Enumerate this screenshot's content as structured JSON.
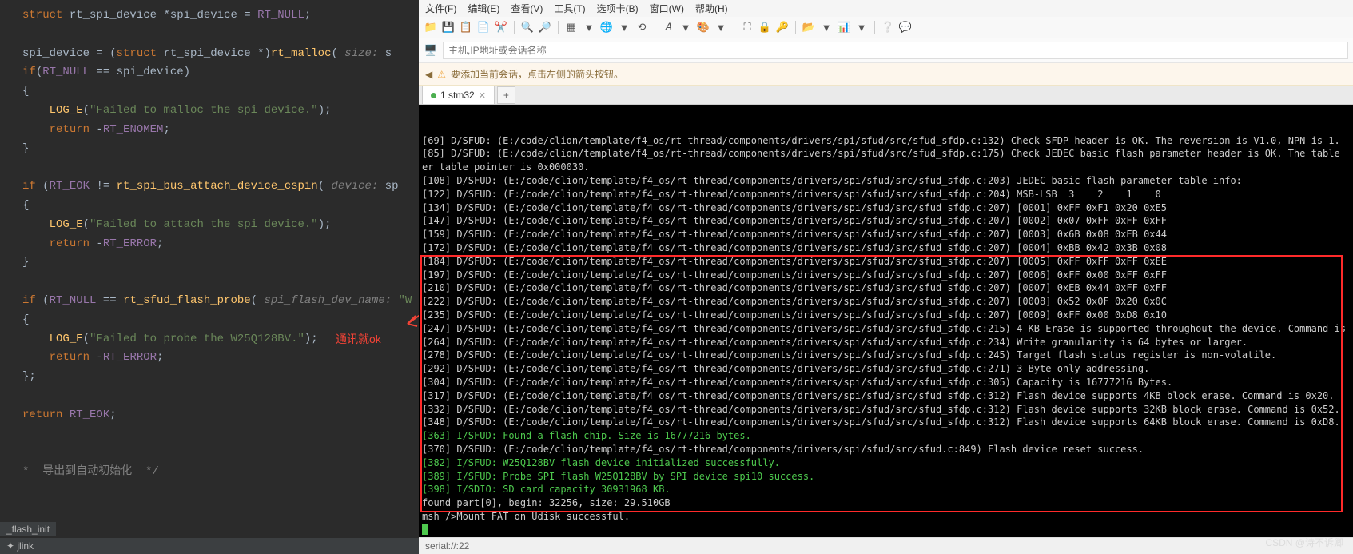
{
  "editor": {
    "bottom_tab": "_flash_init",
    "status": "✦ jlink",
    "annotation": "通讯就ok",
    "code_tokens": [
      [
        {
          "c": "kw",
          "t": "struct"
        },
        {
          "c": "",
          "t": " rt_spi_device *spi_device = "
        },
        {
          "c": "macro",
          "t": "RT_NULL"
        },
        {
          "c": "",
          "t": ";"
        }
      ],
      [],
      [
        {
          "c": "",
          "t": "spi_device = ("
        },
        {
          "c": "kw",
          "t": "struct"
        },
        {
          "c": "",
          "t": " rt_spi_device *)"
        },
        {
          "c": "fn",
          "t": "rt_malloc"
        },
        {
          "c": "",
          "t": "("
        },
        {
          "c": "param",
          "t": " size:"
        },
        {
          "c": "",
          "t": " s"
        }
      ],
      [
        {
          "c": "kw",
          "t": "if"
        },
        {
          "c": "",
          "t": "("
        },
        {
          "c": "macro",
          "t": "RT_NULL"
        },
        {
          "c": "",
          "t": " == spi_device)"
        }
      ],
      [
        {
          "c": "",
          "t": "{"
        }
      ],
      [
        {
          "c": "",
          "t": "    "
        },
        {
          "c": "fn",
          "t": "LOG_E"
        },
        {
          "c": "",
          "t": "("
        },
        {
          "c": "str",
          "t": "\"Failed to malloc the spi device.\""
        },
        {
          "c": "",
          "t": ");"
        }
      ],
      [
        {
          "c": "",
          "t": "    "
        },
        {
          "c": "kw",
          "t": "return"
        },
        {
          "c": "",
          "t": " -"
        },
        {
          "c": "macro",
          "t": "RT_ENOMEM"
        },
        {
          "c": "",
          "t": ";"
        }
      ],
      [
        {
          "c": "",
          "t": "}"
        }
      ],
      [],
      [
        {
          "c": "kw",
          "t": "if"
        },
        {
          "c": "",
          "t": " ("
        },
        {
          "c": "macro",
          "t": "RT_EOK"
        },
        {
          "c": "",
          "t": " != "
        },
        {
          "c": "fn",
          "t": "rt_spi_bus_attach_device_cspin"
        },
        {
          "c": "",
          "t": "("
        },
        {
          "c": "param",
          "t": " device:"
        },
        {
          "c": "",
          "t": " sp"
        }
      ],
      [
        {
          "c": "",
          "t": "{"
        }
      ],
      [
        {
          "c": "",
          "t": "    "
        },
        {
          "c": "fn",
          "t": "LOG_E"
        },
        {
          "c": "",
          "t": "("
        },
        {
          "c": "str",
          "t": "\"Failed to attach the spi device.\""
        },
        {
          "c": "",
          "t": ");"
        }
      ],
      [
        {
          "c": "",
          "t": "    "
        },
        {
          "c": "kw",
          "t": "return"
        },
        {
          "c": "",
          "t": " -"
        },
        {
          "c": "macro",
          "t": "RT_ERROR"
        },
        {
          "c": "",
          "t": ";"
        }
      ],
      [
        {
          "c": "",
          "t": "}"
        }
      ],
      [],
      [
        {
          "c": "kw",
          "t": "if"
        },
        {
          "c": "",
          "t": " ("
        },
        {
          "c": "macro",
          "t": "RT_NULL"
        },
        {
          "c": "",
          "t": " == "
        },
        {
          "c": "fn",
          "t": "rt_sfud_flash_probe"
        },
        {
          "c": "",
          "t": "("
        },
        {
          "c": "param",
          "t": " spi_flash_dev_name:"
        },
        {
          "c": "",
          "t": " "
        },
        {
          "c": "str",
          "t": "\"W"
        }
      ],
      [
        {
          "c": "",
          "t": "{"
        }
      ],
      [
        {
          "c": "",
          "t": "    "
        },
        {
          "c": "fn",
          "t": "LOG_E"
        },
        {
          "c": "",
          "t": "("
        },
        {
          "c": "str",
          "t": "\"Failed to probe the W25Q128BV.\""
        },
        {
          "c": "",
          "t": ");"
        }
      ],
      [
        {
          "c": "",
          "t": "    "
        },
        {
          "c": "kw",
          "t": "return"
        },
        {
          "c": "",
          "t": " -"
        },
        {
          "c": "macro",
          "t": "RT_ERROR"
        },
        {
          "c": "",
          "t": ";"
        }
      ],
      [
        {
          "c": "",
          "t": "};"
        }
      ],
      [],
      [
        {
          "c": "kw",
          "t": "return"
        },
        {
          "c": "",
          "t": " "
        },
        {
          "c": "macro",
          "t": "RT_EOK"
        },
        {
          "c": "",
          "t": ";"
        }
      ],
      [],
      [],
      [
        {
          "c": "comment",
          "t": "*  导出到自动初始化  */"
        }
      ]
    ]
  },
  "term_app": {
    "menus": [
      "文件(F)",
      "编辑(E)",
      "查看(V)",
      "工具(T)",
      "选项卡(B)",
      "窗口(W)",
      "帮助(H)"
    ],
    "addr_placeholder": "主机,IP地址或会话名称",
    "hint": "要添加当前会话，点击左侧的箭头按钮。",
    "tab_label": "1 stm32",
    "tab_add": "+",
    "status": "serial://:22",
    "watermark": "CSDN @诗不诉卿",
    "lines": [
      {
        "c": "",
        "t": "[69] D/SFUD: (E:/code/clion/template/f4_os/rt-thread/components/drivers/spi/sfud/src/sfud_sfdp.c:132) Check SFDP header is OK. The reversion is V1.0, NPN is 1."
      },
      {
        "c": "",
        "t": "[85] D/SFUD: (E:/code/clion/template/f4_os/rt-thread/components/drivers/spi/sfud/src/sfud_sfdp.c:175) Check JEDEC basic flash parameter header is OK. The table"
      },
      {
        "c": "",
        "t": "er table pointer is 0x000030."
      },
      {
        "c": "",
        "t": "[108] D/SFUD: (E:/code/clion/template/f4_os/rt-thread/components/drivers/spi/sfud/src/sfud_sfdp.c:203) JEDEC basic flash parameter table info:"
      },
      {
        "c": "",
        "t": "[122] D/SFUD: (E:/code/clion/template/f4_os/rt-thread/components/drivers/spi/sfud/src/sfud_sfdp.c:204) MSB-LSB  3    2    1    0"
      },
      {
        "c": "",
        "t": "[134] D/SFUD: (E:/code/clion/template/f4_os/rt-thread/components/drivers/spi/sfud/src/sfud_sfdp.c:207) [0001] 0xFF 0xF1 0x20 0xE5"
      },
      {
        "c": "",
        "t": "[147] D/SFUD: (E:/code/clion/template/f4_os/rt-thread/components/drivers/spi/sfud/src/sfud_sfdp.c:207) [0002] 0x07 0xFF 0xFF 0xFF"
      },
      {
        "c": "",
        "t": "[159] D/SFUD: (E:/code/clion/template/f4_os/rt-thread/components/drivers/spi/sfud/src/sfud_sfdp.c:207) [0003] 0x6B 0x08 0xEB 0x44"
      },
      {
        "c": "",
        "t": "[172] D/SFUD: (E:/code/clion/template/f4_os/rt-thread/components/drivers/spi/sfud/src/sfud_sfdp.c:207) [0004] 0xBB 0x42 0x3B 0x08"
      },
      {
        "c": "",
        "t": "[184] D/SFUD: (E:/code/clion/template/f4_os/rt-thread/components/drivers/spi/sfud/src/sfud_sfdp.c:207) [0005] 0xFF 0xFF 0xFF 0xEE"
      },
      {
        "c": "",
        "t": "[197] D/SFUD: (E:/code/clion/template/f4_os/rt-thread/components/drivers/spi/sfud/src/sfud_sfdp.c:207) [0006] 0xFF 0x00 0xFF 0xFF"
      },
      {
        "c": "",
        "t": "[210] D/SFUD: (E:/code/clion/template/f4_os/rt-thread/components/drivers/spi/sfud/src/sfud_sfdp.c:207) [0007] 0xEB 0x44 0xFF 0xFF"
      },
      {
        "c": "",
        "t": "[222] D/SFUD: (E:/code/clion/template/f4_os/rt-thread/components/drivers/spi/sfud/src/sfud_sfdp.c:207) [0008] 0x52 0x0F 0x20 0x0C"
      },
      {
        "c": "",
        "t": "[235] D/SFUD: (E:/code/clion/template/f4_os/rt-thread/components/drivers/spi/sfud/src/sfud_sfdp.c:207) [0009] 0xFF 0x00 0xD8 0x10"
      },
      {
        "c": "",
        "t": "[247] D/SFUD: (E:/code/clion/template/f4_os/rt-thread/components/drivers/spi/sfud/src/sfud_sfdp.c:215) 4 KB Erase is supported throughout the device. Command is"
      },
      {
        "c": "",
        "t": "[264] D/SFUD: (E:/code/clion/template/f4_os/rt-thread/components/drivers/spi/sfud/src/sfud_sfdp.c:234) Write granularity is 64 bytes or larger."
      },
      {
        "c": "",
        "t": "[278] D/SFUD: (E:/code/clion/template/f4_os/rt-thread/components/drivers/spi/sfud/src/sfud_sfdp.c:245) Target flash status register is non-volatile."
      },
      {
        "c": "",
        "t": "[292] D/SFUD: (E:/code/clion/template/f4_os/rt-thread/components/drivers/spi/sfud/src/sfud_sfdp.c:271) 3-Byte only addressing."
      },
      {
        "c": "",
        "t": "[304] D/SFUD: (E:/code/clion/template/f4_os/rt-thread/components/drivers/spi/sfud/src/sfud_sfdp.c:305) Capacity is 16777216 Bytes."
      },
      {
        "c": "",
        "t": "[317] D/SFUD: (E:/code/clion/template/f4_os/rt-thread/components/drivers/spi/sfud/src/sfud_sfdp.c:312) Flash device supports 4KB block erase. Command is 0x20."
      },
      {
        "c": "",
        "t": "[332] D/SFUD: (E:/code/clion/template/f4_os/rt-thread/components/drivers/spi/sfud/src/sfud_sfdp.c:312) Flash device supports 32KB block erase. Command is 0x52."
      },
      {
        "c": "",
        "t": "[348] D/SFUD: (E:/code/clion/template/f4_os/rt-thread/components/drivers/spi/sfud/src/sfud_sfdp.c:312) Flash device supports 64KB block erase. Command is 0xD8."
      },
      {
        "c": "info",
        "t": "[363] I/SFUD: Found a flash chip. Size is 16777216 bytes."
      },
      {
        "c": "",
        "t": "[370] D/SFUD: (E:/code/clion/template/f4_os/rt-thread/components/drivers/spi/sfud/src/sfud.c:849) Flash device reset success."
      },
      {
        "c": "info",
        "t": "[382] I/SFUD: W25Q128BV flash device initialized successfully."
      },
      {
        "c": "info",
        "t": "[389] I/SFUD: Probe SPI flash W25Q128BV by SPI device spi10 success."
      },
      {
        "c": "info",
        "t": "[398] I/SDIO: SD card capacity 30931968 KB."
      },
      {
        "c": "",
        "t": "found part[0], begin: 32256, size: 29.510GB"
      },
      {
        "c": "",
        "t": "msh />Mount FAT on Udisk successful."
      }
    ]
  },
  "toolbar_icons": [
    "📁",
    "💾",
    "📋",
    "📄",
    "✂️",
    "|",
    "🔍",
    "🔎",
    "|",
    "▦",
    "▼",
    "🌐",
    "▼",
    "⟲",
    "|",
    "𝐴",
    "▼",
    "🎨",
    "▼",
    "|",
    "⛶",
    "🔒",
    "🔑",
    "|",
    "📂",
    "▼",
    "📊",
    "▼",
    "|",
    "❔",
    "💬"
  ]
}
